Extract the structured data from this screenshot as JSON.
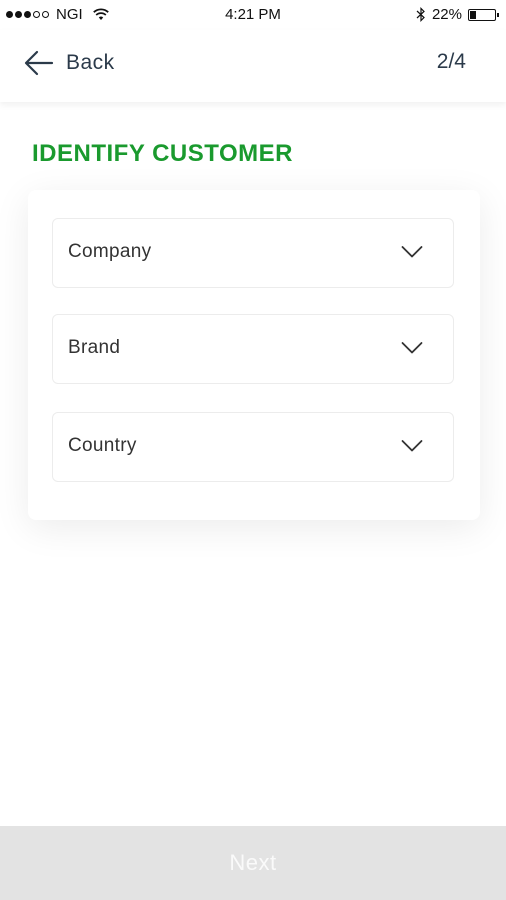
{
  "status_bar": {
    "carrier": "NGI",
    "time": "4:21 PM",
    "battery_text": "22%",
    "battery_level": 0.22,
    "signal_filled": 3,
    "signal_total": 5
  },
  "nav": {
    "back_label": "Back",
    "step": "2/4"
  },
  "page": {
    "title": "IDENTIFY CUSTOMER"
  },
  "form": {
    "dropdowns": [
      {
        "label": "Company"
      },
      {
        "label": "Brand"
      },
      {
        "label": "Country"
      }
    ]
  },
  "footer": {
    "next_label": "Next"
  },
  "colors": {
    "accent_green": "#1a9a2e",
    "disabled_button": "#e3e3e3"
  },
  "icons": [
    "wifi-icon",
    "bluetooth-icon",
    "battery-icon",
    "back-arrow-icon",
    "chevron-down-icon"
  ]
}
